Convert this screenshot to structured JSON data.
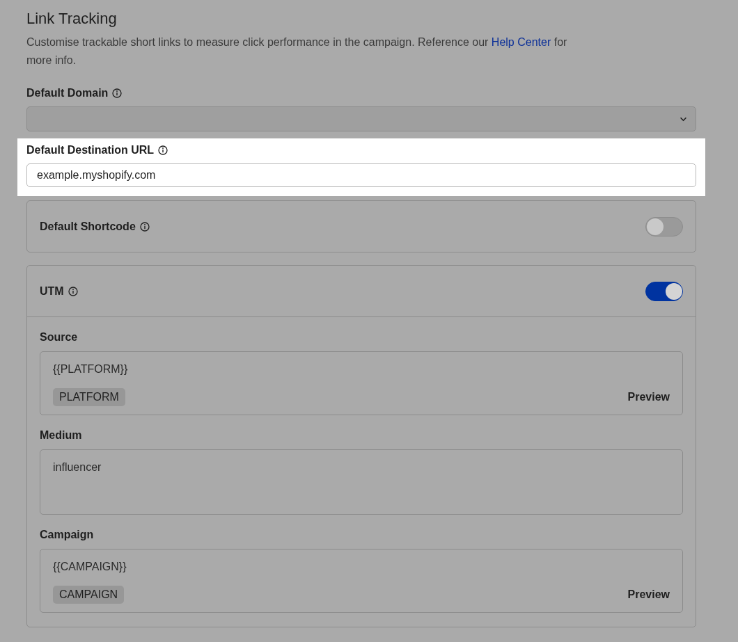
{
  "title": "Link Tracking",
  "description": {
    "before": "Customise trackable short links to measure click performance in the campaign. Reference our",
    "link": "Help Center",
    "after": "for more info."
  },
  "fields": [
    {
      "kind": "select",
      "label": "Default Domain",
      "spotlight": false
    },
    {
      "kind": "input",
      "label": "Default Destination URL",
      "value": "example.myshopify.com",
      "spotlight": true
    }
  ],
  "shortcode": {
    "label": "Default Shortcode",
    "on": false
  },
  "utm": {
    "label": "UTM",
    "on": true,
    "fields": [
      {
        "kind": "template",
        "label": "Source",
        "value": "{{PLATFORM}}",
        "tag": "PLATFORM",
        "action": "Preview"
      },
      {
        "kind": "text",
        "label": "Medium",
        "value": "influencer"
      },
      {
        "kind": "template",
        "label": "Campaign",
        "value": "{{CAMPAIGN}}",
        "tag": "CAMPAIGN",
        "action": "Preview"
      }
    ]
  }
}
